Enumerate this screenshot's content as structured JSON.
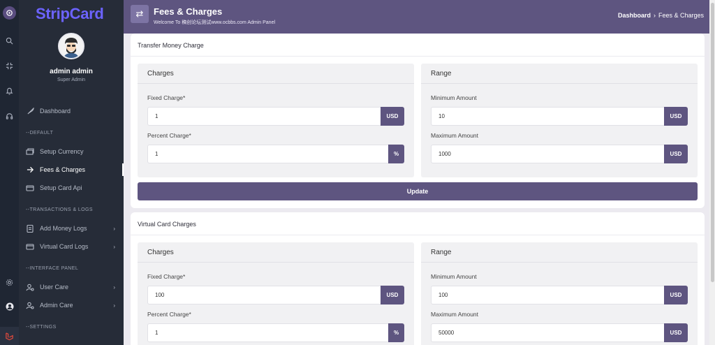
{
  "sidebar": {
    "brand": "StripCard",
    "user_name": "admin admin",
    "user_role": "Super Admin",
    "items": {
      "dashboard": "Dashboard",
      "section_default": "--DEFAULT",
      "setup_currency": "Setup Currency",
      "fees_charges": "Fees & Charges",
      "setup_card_api": "Setup Card Api",
      "section_transactions": "--TRANSACTIONS & LOGS",
      "add_money_logs": "Add Money Logs",
      "virtual_card_logs": "Virtual Card Logs",
      "section_interface": "--INTERFACE PANEL",
      "user_care": "User Care",
      "admin_care": "Admin Care",
      "section_settings": "--SETTINGS"
    }
  },
  "header": {
    "title": "Fees & Charges",
    "subtitle": "Welcome To 稿创论坛测试www.ocbbs.com Admin Panel",
    "breadcrumb_home": "Dashboard",
    "breadcrumb_current": "Fees & Charges"
  },
  "transfer": {
    "title": "Transfer Money Charge",
    "charges_title": "Charges",
    "range_title": "Range",
    "fixed_label": "Fixed Charge*",
    "fixed_value": "1",
    "fixed_unit": "USD",
    "percent_label": "Percent Charge*",
    "percent_value": "1",
    "percent_unit": "%",
    "min_label": "Minimum Amount",
    "min_value": "10",
    "min_unit": "USD",
    "max_label": "Maximum Amount",
    "max_value": "1000",
    "max_unit": "USD",
    "update_label": "Update"
  },
  "virtual": {
    "title": "Virtual Card Charges",
    "charges_title": "Charges",
    "range_title": "Range",
    "fixed_label": "Fixed Charge*",
    "fixed_value": "100",
    "fixed_unit": "USD",
    "percent_label": "Percent Charge*",
    "percent_value": "1",
    "percent_unit": "%",
    "min_label": "Minimum Amount",
    "min_value": "100",
    "min_unit": "USD",
    "max_label": "Maximum Amount",
    "max_value": "50000",
    "max_unit": "USD"
  },
  "colors": {
    "accent": "#5e5580",
    "brand": "#6c63ff",
    "sidebar": "#262c38"
  }
}
